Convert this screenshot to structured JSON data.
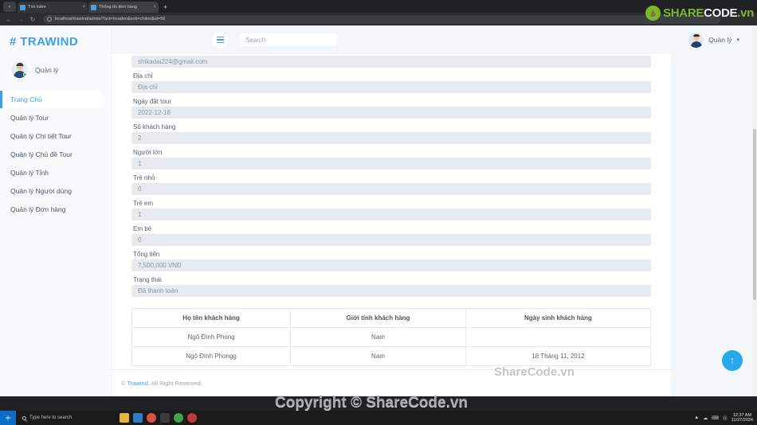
{
  "browser": {
    "tabs": [
      {
        "title": "Tìm kiếm",
        "active": false,
        "favicon_color": "#4a9de0",
        "close_label": "×"
      },
      {
        "title": "Thông tin đơn hàng",
        "active": true,
        "favicon_color": "#4a9de0",
        "close_label": "×"
      }
    ],
    "new_tab_label": "+",
    "nav": {
      "back": "←",
      "forward": "→",
      "reload": "↻"
    },
    "url": "localhost/trawind/admin/?act=hoadon&sub=chitiet&id=56"
  },
  "watermark_logo": {
    "share": "SHARE",
    "code": "CODE",
    "vn": ".vn"
  },
  "sidebar": {
    "brand": "# TRAWIND",
    "profile_name": "Quản lý",
    "items": [
      {
        "label": "Trang Chủ",
        "active": true
      },
      {
        "label": "Quản lý Tour",
        "active": false
      },
      {
        "label": "Quản lý Chi tiết Tour",
        "active": false
      },
      {
        "label": "Quản lý Chủ đề Tour",
        "active": false
      },
      {
        "label": "Quản lý Tỉnh",
        "active": false
      },
      {
        "label": "Quản lý Người dùng",
        "active": false
      },
      {
        "label": "Quản lý Đơn hàng",
        "active": false
      }
    ]
  },
  "topbar": {
    "menu_toggle_label": "menu",
    "search_placeholder": "Search",
    "user_name": "Quản lý",
    "caret": "▾"
  },
  "form": {
    "fields": [
      {
        "label": "",
        "value": "shikadai224@gmail.com",
        "show_label": false
      },
      {
        "label": "Địa chỉ",
        "value": "Địa chỉ",
        "show_label": true
      },
      {
        "label": "Ngày đặt tour",
        "value": "2022-12-18",
        "show_label": true
      },
      {
        "label": "Số khách hàng",
        "value": "2",
        "show_label": true
      },
      {
        "label": "Người lớn",
        "value": "1",
        "show_label": true
      },
      {
        "label": "Trẻ nhỏ",
        "value": "0",
        "show_label": true
      },
      {
        "label": "Trẻ em",
        "value": "1",
        "show_label": true
      },
      {
        "label": "Em bé",
        "value": "0",
        "show_label": true
      },
      {
        "label": "Tổng tiền",
        "value": "7,500,000 VNĐ",
        "show_label": true
      },
      {
        "label": "Trạng thái",
        "value": "Đã thanh toán",
        "show_label": true
      }
    ]
  },
  "table": {
    "headers": [
      "Họ tên khách hàng",
      "Giới tính khách hàng",
      "Ngày sinh khách hàng"
    ],
    "rows": [
      [
        "Ngô Đình Phong",
        "Nam",
        ""
      ],
      [
        "Ngô Đình Phongg",
        "Nam",
        "18 Tháng 11, 2012"
      ]
    ]
  },
  "footer": {
    "copy_symbol": "© ",
    "brand": "Trawind",
    "rest": ", All Right Reserved."
  },
  "scroll_top": {
    "icon": "↑"
  },
  "watermarks": {
    "table": "ShareCode.vn",
    "bottom": "Copyright © ShareCode.vn"
  },
  "taskbar": {
    "search_placeholder": "Type here to search",
    "apps": [
      {
        "name": "file-explorer-icon",
        "color": "#e8b33a"
      },
      {
        "name": "vscode-icon",
        "color": "#2b7fc4"
      },
      {
        "name": "chrome-icon",
        "color": "#dd5044"
      },
      {
        "name": "terminal-icon",
        "color": "#3a3a3a"
      },
      {
        "name": "xampp-icon",
        "color": "#3fa34d"
      },
      {
        "name": "media-icon",
        "color": "#c23b3b"
      }
    ],
    "tray_icons": [
      "▲",
      "☁",
      "⌨",
      "Ⓞ"
    ],
    "time": "12:37 AM",
    "date": "11/27/2024"
  }
}
